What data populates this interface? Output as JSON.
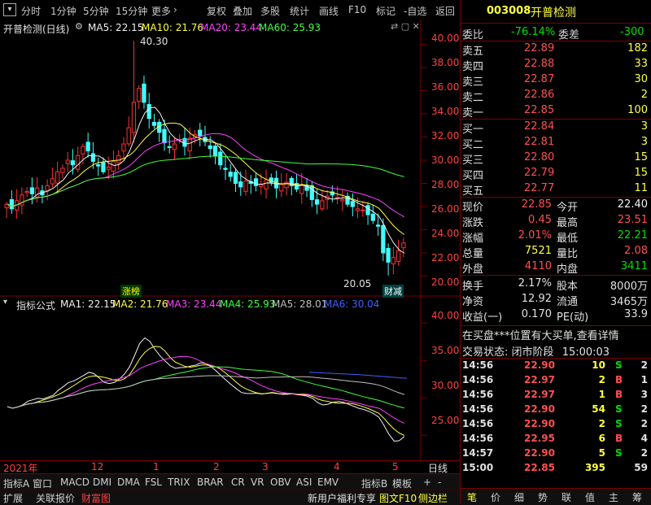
{
  "toolbar": {
    "items": [
      "分时",
      "1分钟",
      "5分钟",
      "15分钟",
      "更多",
      "复权",
      "叠加",
      "多股",
      "统计",
      "画线",
      "F10",
      "标记",
      "-自选",
      "返回"
    ]
  },
  "stock": {
    "code": "003008",
    "name": "开普检测",
    "title": "开普检测(日线)"
  },
  "ma_legend": {
    "ma5": "MA5: 22.15",
    "ma10": "MA10: 21.76",
    "ma20": "MA20: 23.44",
    "ma60": "MA60: 25.93"
  },
  "price_axis": [
    "40.00",
    "38.00",
    "36.00",
    "34.00",
    "32.00",
    "30.00",
    "28.00",
    "26.00",
    "24.00",
    "22.00",
    "20.00"
  ],
  "annotations": {
    "high": "40.30",
    "low": "20.05",
    "tag1": "涨榜",
    "tag2": "财减"
  },
  "indicator": {
    "title": "指标公式",
    "ma1": "MA1: 22.15",
    "ma2": "MA2: 21.76",
    "ma3": "MA3: 23.44",
    "ma4": "MA4: 25.93",
    "ma5": "MA5: 28.01",
    "ma6": "MA6: 30.04",
    "axis": [
      "40.00",
      "35.00",
      "30.00",
      "25.00"
    ]
  },
  "date_axis": {
    "year": "2021年",
    "m12": "12",
    "m1": "1",
    "m2": "2",
    "m3": "3",
    "m4": "4",
    "m5": "5",
    "label": "日线"
  },
  "tabs": [
    "指标A",
    "窗口",
    "MACD",
    "DMI",
    "DMA",
    "FSL",
    "TRIX",
    "BRAR",
    "CR",
    "VR",
    "OBV",
    "ASI",
    "EMV",
    "指标B",
    "模板"
  ],
  "bottom": {
    "ext": "扩展",
    "related": "关联报价",
    "wealth": "财富图",
    "welfare": "新用户福利专享",
    "f10": "图文F10",
    "side": "侧边栏"
  },
  "bottom_right": [
    "笔",
    "价",
    "细",
    "势",
    "联",
    "值",
    "主",
    "筹"
  ],
  "order_ratio": {
    "label1": "委比",
    "val1": "-76.14%",
    "label2": "委差",
    "val2": "-300"
  },
  "asks": [
    {
      "name": "卖五",
      "price": "22.89",
      "vol": "182"
    },
    {
      "name": "卖四",
      "price": "22.88",
      "vol": "33"
    },
    {
      "name": "卖三",
      "price": "22.87",
      "vol": "30"
    },
    {
      "name": "卖二",
      "price": "22.86",
      "vol": "2"
    },
    {
      "name": "卖一",
      "price": "22.85",
      "vol": "100"
    }
  ],
  "bids": [
    {
      "name": "买一",
      "price": "22.84",
      "vol": "3"
    },
    {
      "name": "买二",
      "price": "22.81",
      "vol": "3"
    },
    {
      "name": "买三",
      "price": "22.80",
      "vol": "15"
    },
    {
      "name": "买四",
      "price": "22.79",
      "vol": "15"
    },
    {
      "name": "买五",
      "price": "22.77",
      "vol": "11"
    }
  ],
  "quote": [
    {
      "l1": "现价",
      "v1": "22.85",
      "l2": "今开",
      "v2": "22.40"
    },
    {
      "l1": "涨跌",
      "v1": "0.45",
      "l2": "最高",
      "v2": "23.51"
    },
    {
      "l1": "涨幅",
      "v1": "2.01%",
      "l2": "最低",
      "v2": "22.21"
    },
    {
      "l1": "总量",
      "v1": "7521",
      "l2": "量比",
      "v2": "2.08"
    },
    {
      "l1": "外盘",
      "v1": "4110",
      "l2": "内盘",
      "v2": "3411"
    }
  ],
  "stats": [
    {
      "l1": "换手",
      "v1": "2.17%",
      "l2": "股本",
      "v2": "8000万"
    },
    {
      "l1": "净资",
      "v1": "12.92",
      "l2": "流通",
      "v2": "3465万"
    },
    {
      "l1": "收益(一)",
      "v1": "0.170",
      "l2": "PE(动)",
      "v2": "33.9"
    }
  ],
  "notice": "在买盘***位置有大买单,查看详情",
  "status": {
    "label": "交易状态:",
    "value": "闭市阶段",
    "time": "15:00:03"
  },
  "trades": [
    {
      "t": "14:56",
      "p": "22.90",
      "v": "10",
      "s": "S"
    },
    {
      "t": "14:56",
      "p": "22.97",
      "v": "2",
      "s": "B"
    },
    {
      "t": "14:56",
      "p": "22.97",
      "v": "1",
      "s": "B"
    },
    {
      "t": "14:56",
      "p": "22.90",
      "v": "54",
      "s": "S"
    },
    {
      "t": "14:56",
      "p": "22.90",
      "v": "2",
      "s": "S"
    },
    {
      "t": "14:56",
      "p": "22.95",
      "v": "6",
      "s": "B"
    },
    {
      "t": "14:57",
      "p": "22.90",
      "v": "5",
      "s": "S"
    },
    {
      "t": "15:00",
      "p": "22.85",
      "v": "395",
      "s": ""
    }
  ],
  "trade_extra": {
    "c1": "2",
    "c2": "1",
    "c3": "3",
    "c4": "2",
    "c5": "2",
    "c6": "4",
    "c7": "59"
  },
  "chart_data": {
    "type": "candlestick",
    "ylim": [
      19.0,
      41.0
    ],
    "closes": [
      26.2,
      25.8,
      26.5,
      27.0,
      27.3,
      27.1,
      27.6,
      27.0,
      27.8,
      28.4,
      29.0,
      29.3,
      30.0,
      29.6,
      30.4,
      31.2,
      30.8,
      29.9,
      29.5,
      29.0,
      29.4,
      29.9,
      30.4,
      31.4,
      32.8,
      35.0,
      36.2,
      35.0,
      33.6,
      33.0,
      32.4,
      31.5,
      31.1,
      31.4,
      31.8,
      31.2,
      31.9,
      32.2,
      32.1,
      31.6,
      31.0,
      30.4,
      29.6,
      29.2,
      28.6,
      28.0,
      27.7,
      28.2,
      28.0,
      27.8,
      27.9,
      28.3,
      28.1,
      27.6,
      27.9,
      28.1,
      27.8,
      27.5,
      27.9,
      27.4,
      26.6,
      26.2,
      26.5,
      26.9,
      27.0,
      26.8,
      26.6,
      26.2,
      26.0,
      25.8,
      25.7,
      25.3,
      24.8,
      24.3,
      22.0,
      21.2,
      21.6,
      22.2,
      22.85
    ],
    "tags": [
      "涨榜",
      "财减"
    ]
  }
}
